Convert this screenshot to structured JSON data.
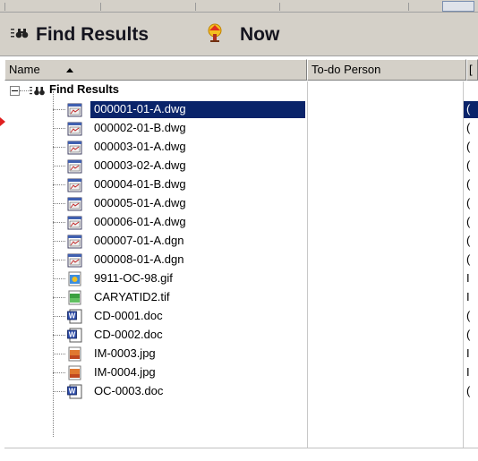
{
  "toolbar": {
    "title": "Find Results",
    "now_label": "Now"
  },
  "columns": {
    "name": "Name",
    "todo": "To-do Person",
    "third_partial": "["
  },
  "tree": {
    "root_label": "Find Results",
    "items": [
      {
        "name": "000001-01-A.dwg",
        "icon": "dwg-file-icon",
        "third": "(",
        "selected": true
      },
      {
        "name": "000002-01-B.dwg",
        "icon": "dwg-file-icon",
        "third": "("
      },
      {
        "name": "000003-01-A.dwg",
        "icon": "dwg-file-icon",
        "third": "("
      },
      {
        "name": "000003-02-A.dwg",
        "icon": "dwg-file-icon",
        "third": "("
      },
      {
        "name": "000004-01-B.dwg",
        "icon": "dwg-file-icon",
        "third": "("
      },
      {
        "name": "000005-01-A.dwg",
        "icon": "dwg-file-icon",
        "third": "("
      },
      {
        "name": "000006-01-A.dwg",
        "icon": "dwg-file-icon",
        "third": "("
      },
      {
        "name": "000007-01-A.dgn",
        "icon": "dgn-file-icon",
        "third": "("
      },
      {
        "name": "000008-01-A.dgn",
        "icon": "dgn-file-icon",
        "third": "("
      },
      {
        "name": "9911-OC-98.gif",
        "icon": "gif-file-icon",
        "third": "I"
      },
      {
        "name": "CARYATID2.tif",
        "icon": "tif-file-icon",
        "third": "I"
      },
      {
        "name": "CD-0001.doc",
        "icon": "word-doc-icon",
        "third": "("
      },
      {
        "name": "CD-0002.doc",
        "icon": "word-doc-icon",
        "third": "("
      },
      {
        "name": "IM-0003.jpg",
        "icon": "jpg-file-icon",
        "third": "I"
      },
      {
        "name": "IM-0004.jpg",
        "icon": "jpg-file-icon",
        "third": "I"
      },
      {
        "name": "OC-0003.doc",
        "icon": "word-doc-icon",
        "third": "("
      }
    ]
  },
  "colors": {
    "selection": "#0a246a",
    "chrome": "#d4d0c8",
    "marker": "#e02020"
  }
}
